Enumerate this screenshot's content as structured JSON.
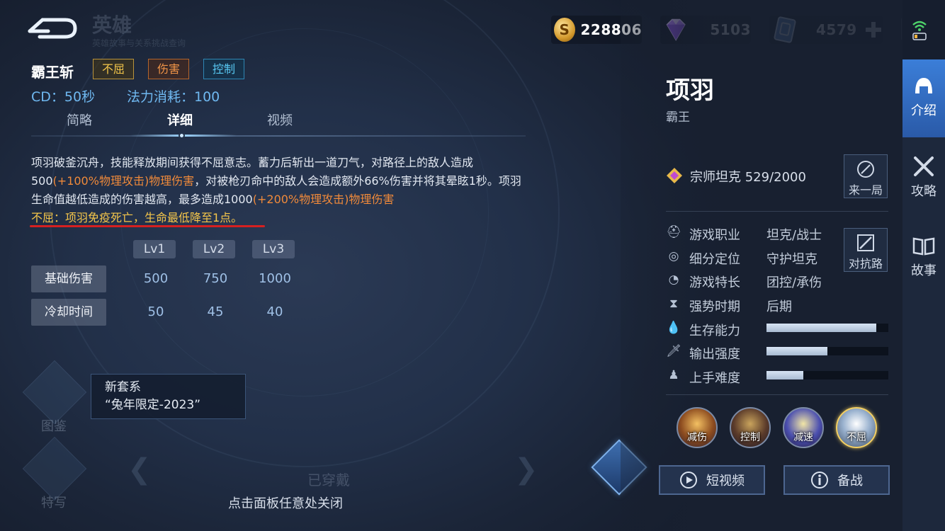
{
  "header": {
    "title": "英雄",
    "subtitle": "英雄故事与关系挑战查询",
    "currencies": [
      {
        "icon": "gold-coin-icon",
        "value": "228806"
      },
      {
        "icon": "diamond-gem-icon",
        "value": "5103"
      },
      {
        "icon": "ticket-card-icon",
        "value": "4579"
      }
    ]
  },
  "skill": {
    "name": "霸王斩",
    "tags": [
      "不屈",
      "伤害",
      "控制"
    ],
    "cd": "CD：50秒",
    "mana": "法力消耗：100",
    "tabs": [
      "简略",
      "详细",
      "视频"
    ],
    "active_tab": "详细",
    "description": {
      "p1": "项羽破釜沉舟，技能释放期间获得不屈意志。蓄力后斩出一道刀气，对路径上的敌人造成500",
      "p2": "(+100%物理攻击)物理伤害",
      "p3": "，对被枪刃命中的敌人会造成额外66%伤害并将其晕眩1秒。项羽生命值越低造成的伤害越高，最多造成1000",
      "p4": "(+200%物理攻击)物理伤害",
      "p5": "不屈：项羽免疫死亡，生命最低降至1点。"
    },
    "levels": [
      "Lv1",
      "Lv2",
      "Lv3"
    ],
    "rows": [
      {
        "label": "基础伤害",
        "values": [
          "500",
          "750",
          "1000"
        ]
      },
      {
        "label": "冷却时间",
        "values": [
          "50",
          "45",
          "40"
        ]
      }
    ]
  },
  "bottom": {
    "tip_title": "新套系",
    "tip_text": "“兔年限定-2023”",
    "side_labels": [
      "图鉴",
      "特写"
    ],
    "equipped": "已穿戴",
    "close_hint": "点击面板任意处关闭"
  },
  "hero": {
    "name": "项羽",
    "title": "霸王",
    "rank": "宗师坦克 529/2000",
    "btn_play": "来一局",
    "btn_counter": "对抗路",
    "attrs": [
      {
        "label": "游戏职业",
        "value": "坦克/战士"
      },
      {
        "label": "细分定位",
        "value": "守护坦克"
      },
      {
        "label": "游戏特长",
        "value": "团控/承伤"
      },
      {
        "label": "强势时期",
        "value": "后期"
      }
    ],
    "bars": [
      {
        "label": "生存能力",
        "fraction": 0.9
      },
      {
        "label": "输出强度",
        "fraction": 0.5
      },
      {
        "label": "上手难度",
        "fraction": 0.3
      }
    ],
    "skill_icons": [
      "减伤",
      "控制",
      "减速",
      "不屈"
    ],
    "btn_video": "短视频",
    "btn_prepare": "备战"
  },
  "rail": {
    "items": [
      "介绍",
      "攻略",
      "故事"
    ],
    "active": "介绍"
  },
  "colors": {
    "accent_blue": "#3b7ed8",
    "tag_gold": "#f3c64a",
    "tag_orange": "#f09447",
    "tag_cyan": "#58c9f3",
    "highlight_orange": "#f08a3a",
    "highlight_yellow": "#f5c64a",
    "underline_red": "#d62020"
  }
}
